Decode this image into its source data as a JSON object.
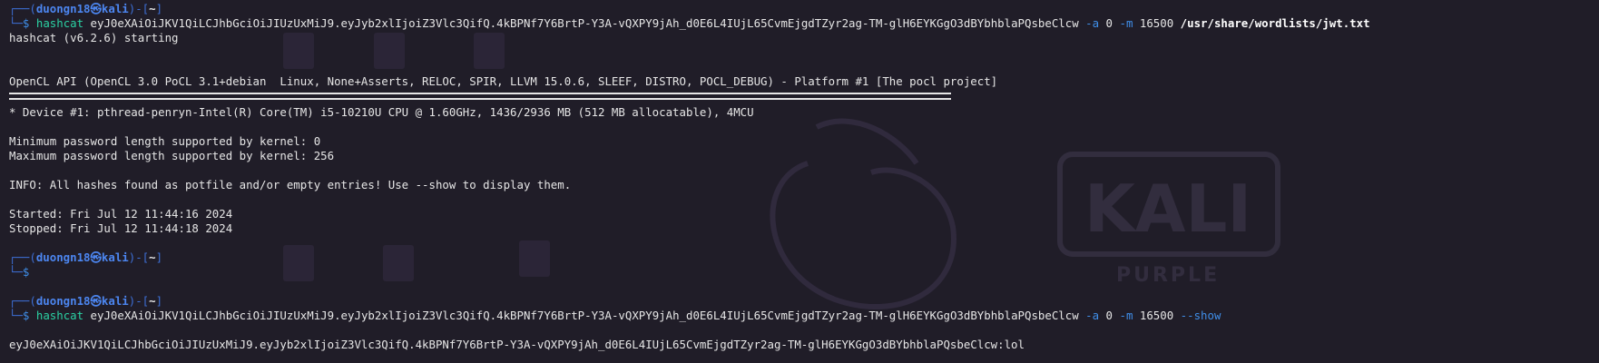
{
  "prompt": {
    "user": "duongn18",
    "at": "㉿",
    "host": "kali",
    "dir": "~",
    "dollar": "$"
  },
  "cmd1": {
    "program": "hashcat",
    "hash": "eyJ0eXAiOiJKV1QiLCJhbGciOiJIUzUxMiJ9.eyJyb2xlIjoiZ3Vlc3QifQ.4kBPNf7Y6BrtP-Y3A-vQXPY9jAh_d0E6L4IUjL65CvmEjgdTZyr2ag-TM-glH6EYKGgO3dBYbhblaPQsbeClcw",
    "flag_a": "-a",
    "mode_a": "0",
    "flag_m": "-m",
    "mode_m": "16500",
    "wordlist": "/usr/share/wordlists/jwt.txt"
  },
  "output": {
    "starting": "hashcat (v6.2.6) starting",
    "opencl": "OpenCL API (OpenCL 3.0 PoCL 3.1+debian  Linux, None+Asserts, RELOC, SPIR, LLVM 15.0.6, SLEEF, DISTRO, POCL_DEBUG) - Platform #1 [The pocl project]",
    "device": "* Device #1: pthread-penryn-Intel(R) Core(TM) i5-10210U CPU @ 1.60GHz, 1436/2936 MB (512 MB allocatable), 4MCU",
    "min_pw": "Minimum password length supported by kernel: 0",
    "max_pw": "Maximum password length supported by kernel: 256",
    "info": "INFO: All hashes found as potfile and/or empty entries! Use --show to display them.",
    "started": "Started: Fri Jul 12 11:44:16 2024",
    "stopped": "Stopped: Fri Jul 12 11:44:18 2024"
  },
  "cmd2": {
    "program": "hashcat",
    "hash": "eyJ0eXAiOiJKV1QiLCJhbGciOiJIUzUxMiJ9.eyJyb2xlIjoiZ3Vlc3QifQ.4kBPNf7Y6BrtP-Y3A-vQXPY9jAh_d0E6L4IUjL65CvmEjgdTZyr2ag-TM-glH6EYKGgO3dBYbhblaPQsbeClcw",
    "flag_a": "-a",
    "mode_a": "0",
    "flag_m": "-m",
    "mode_m": "16500",
    "show": "--show"
  },
  "result": "eyJ0eXAiOiJKV1QiLCJhbGciOiJIUzUxMiJ9.eyJyb2xlIjoiZ3Vlc3QifQ.4kBPNf7Y6BrtP-Y3A-vQXPY9jAh_d0E6L4IUjL65CvmEjgdTZyr2ag-TM-glH6EYKGgO3dBYbhblaPQsbeClcw:lol",
  "wallpaper": {
    "logo_text": "KALI",
    "logo_sub": "PURPLE"
  },
  "colors": {
    "background": "#201d28",
    "prompt": "#4c86f0",
    "command": "#2bd1a3"
  }
}
